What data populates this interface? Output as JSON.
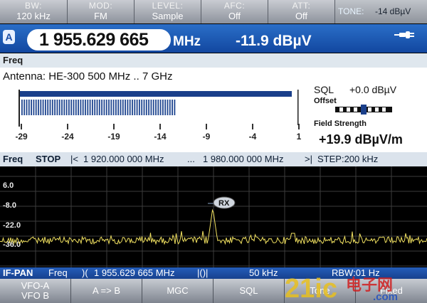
{
  "top_softkeys": [
    {
      "label": "BW:",
      "value": "120 kHz"
    },
    {
      "label": "MOD:",
      "value": "FM"
    },
    {
      "label": "LEVEL:",
      "value": "Sample"
    },
    {
      "label": "AFC:",
      "value": "Off"
    },
    {
      "label": "ATT:",
      "value": "Off"
    }
  ],
  "tone": {
    "label": "TONE:",
    "value": "-14 dBµV"
  },
  "header": {
    "vfo": "A",
    "frequency": "1 955.629 665",
    "unit": "MHz",
    "level": "-11.9 dBµV"
  },
  "panel": {
    "title": "Freq",
    "antenna": "Antenna:  HE-300 500 MHz .. 7 GHz",
    "scale_ticks": [
      "-29",
      "-24",
      "-19",
      "-14",
      "-9",
      "-4",
      "1"
    ],
    "bar_fill": 0.56,
    "sql_label": "SQL",
    "sql_value": "+0.0 dBµV",
    "offset_label": "Offset",
    "field_label": "Field Strength",
    "field_value": "+19.9 dBµV/m"
  },
  "status_line": {
    "mode": "Freq",
    "state": "STOP",
    "start": "1 920.000 000 MHz",
    "sep": "...",
    "stop": "1 980.000 000 MHz",
    "step": "STEP:200 kHz"
  },
  "spectrum": {
    "y_labels": [
      "6.0",
      "-8.0",
      "-22.0",
      "-36.0"
    ],
    "marker": "RX"
  },
  "ifpan": {
    "label": "IF-PAN",
    "mode": "Freq",
    "frequency": "1 955.629 665 MHz",
    "span": "50 kHz",
    "rbw": "RBW:01 Hz"
  },
  "bottom_softkeys": [
    {
      "line1": "VFO-A",
      "line2": "VFO B"
    },
    {
      "label": "A => B"
    },
    {
      "label": "MGC"
    },
    {
      "label": "SQL"
    },
    {
      "label": "Tone"
    },
    {
      "label": "Fixed"
    }
  ],
  "watermark": {
    "text": "21ic",
    "suffix": "电子网",
    "domain": ".com"
  },
  "colors": {
    "header_blue": "#1a56b4",
    "trace": "#f0e060",
    "background": "#000000"
  }
}
